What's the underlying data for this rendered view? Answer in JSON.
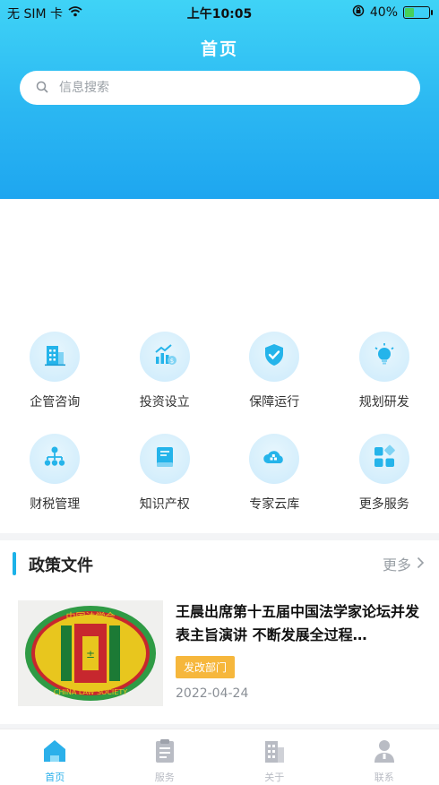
{
  "status_bar": {
    "carrier": "无 SIM 卡",
    "time": "上午10:05",
    "battery_percent": "40%",
    "battery_level": 0.4
  },
  "header": {
    "title": "首页",
    "search_placeholder": "信息搜索"
  },
  "services": [
    {
      "label": "企管咨询",
      "icon": "building-icon"
    },
    {
      "label": "投资设立",
      "icon": "growth-chart-icon"
    },
    {
      "label": "保障运行",
      "icon": "shield-check-icon"
    },
    {
      "label": "规划研发",
      "icon": "lightbulb-icon"
    },
    {
      "label": "财税管理",
      "icon": "org-chart-icon"
    },
    {
      "label": "知识产权",
      "icon": "book-icon"
    },
    {
      "label": "专家云库",
      "icon": "cloud-icon"
    },
    {
      "label": "更多服务",
      "icon": "apps-grid-icon"
    }
  ],
  "policy": {
    "section_title": "政策文件",
    "more_label": "更多",
    "article": {
      "title": "王晨出席第十五届中国法学家论坛并发表主旨演讲 不断发展全过程…",
      "tag": "发改部门",
      "date": "2022-04-24",
      "thumbnail_label": "CHINA LAW SOCIETY",
      "thumbnail_top_text": "中国法学会"
    }
  },
  "tabbar": [
    {
      "label": "首页",
      "icon": "home-icon",
      "active": true
    },
    {
      "label": "服务",
      "icon": "clipboard-icon",
      "active": false
    },
    {
      "label": "关于",
      "icon": "office-building-icon",
      "active": false
    },
    {
      "label": "联系",
      "icon": "person-icon",
      "active": false
    }
  ],
  "colors": {
    "primary": "#1cb2e8",
    "header_gradient_top": "#3fd3f6",
    "header_gradient_bottom": "#1ea6f0",
    "tag": "#f6b73c",
    "tab_inactive": "#b9bcc4"
  }
}
